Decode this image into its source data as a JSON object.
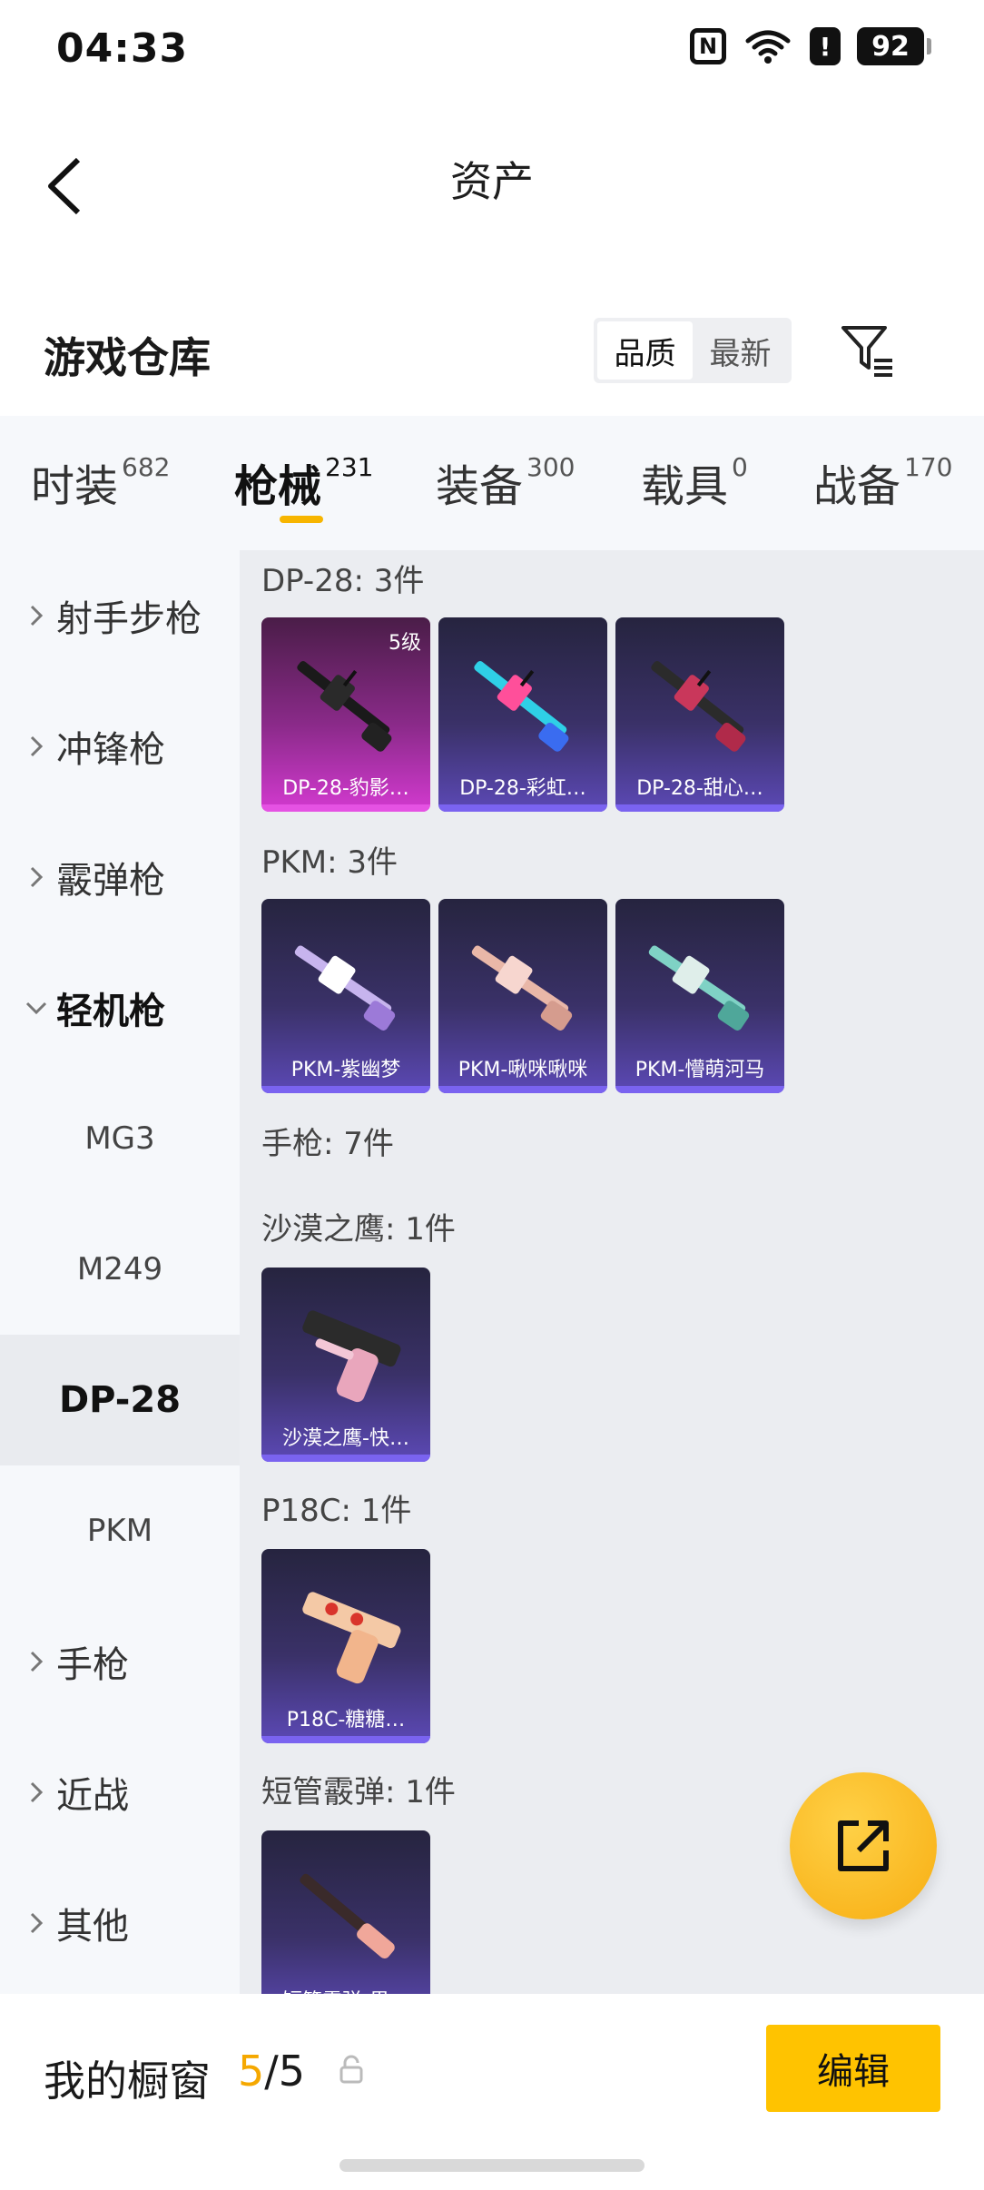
{
  "status": {
    "time": "04:33",
    "nfc": "N",
    "alert": "!",
    "battery": "92"
  },
  "header": {
    "title": "资产"
  },
  "warehouse": {
    "title": "游戏仓库",
    "sort": {
      "quality": "品质",
      "latest": "最新",
      "selected": "品质"
    }
  },
  "tabs": [
    {
      "label": "时装",
      "count": "682"
    },
    {
      "label": "枪械",
      "count": "231",
      "active": true
    },
    {
      "label": "装备",
      "count": "300"
    },
    {
      "label": "载具",
      "count": "0"
    },
    {
      "label": "战备",
      "count": "170"
    }
  ],
  "sidebar": {
    "items": [
      {
        "label": "射手步枪"
      },
      {
        "label": "冲锋枪"
      },
      {
        "label": "霰弹枪"
      },
      {
        "label": "轻机枪",
        "expanded": true
      },
      {
        "label": "MG3"
      },
      {
        "label": "M249"
      },
      {
        "label": "DP-28",
        "selected": true
      },
      {
        "label": "PKM"
      },
      {
        "label": "手枪"
      },
      {
        "label": "近战"
      },
      {
        "label": "其他"
      }
    ]
  },
  "content": {
    "sections": [
      {
        "title": "DP-28: 3件",
        "cards": [
          {
            "label": "DP-28-豹影…",
            "level": "5级"
          },
          {
            "label": "DP-28-彩虹…"
          },
          {
            "label": "DP-28-甜心…"
          }
        ]
      },
      {
        "title": "PKM: 3件",
        "cards": [
          {
            "label": "PKM-紫幽梦"
          },
          {
            "label": "PKM-啾咪啾咪"
          },
          {
            "label": "PKM-懵萌河马"
          }
        ]
      },
      {
        "title": "手枪: 7件",
        "cards": []
      },
      {
        "title": "沙漠之鹰: 1件",
        "cards": [
          {
            "label": "沙漠之鹰-快…"
          }
        ]
      },
      {
        "title": "P18C: 1件",
        "cards": [
          {
            "label": "P18C-糖糖…"
          }
        ]
      },
      {
        "title": "短管霰弹: 1件",
        "cards": [
          {
            "label": "短管霰弹-果…"
          }
        ]
      }
    ]
  },
  "bottom_bar": {
    "title": "我的橱窗",
    "count_current": "5",
    "count_total": "/5",
    "edit_label": "编辑"
  },
  "colors": {
    "accent": "#ffc300",
    "card_purple": "#5c49b6",
    "card_pink": "#d33ad0"
  },
  "icons": [
    "back-arrow-icon",
    "filter-icon",
    "export-icon",
    "lock-icon",
    "chevron-right-icon",
    "chevron-down-icon"
  ]
}
